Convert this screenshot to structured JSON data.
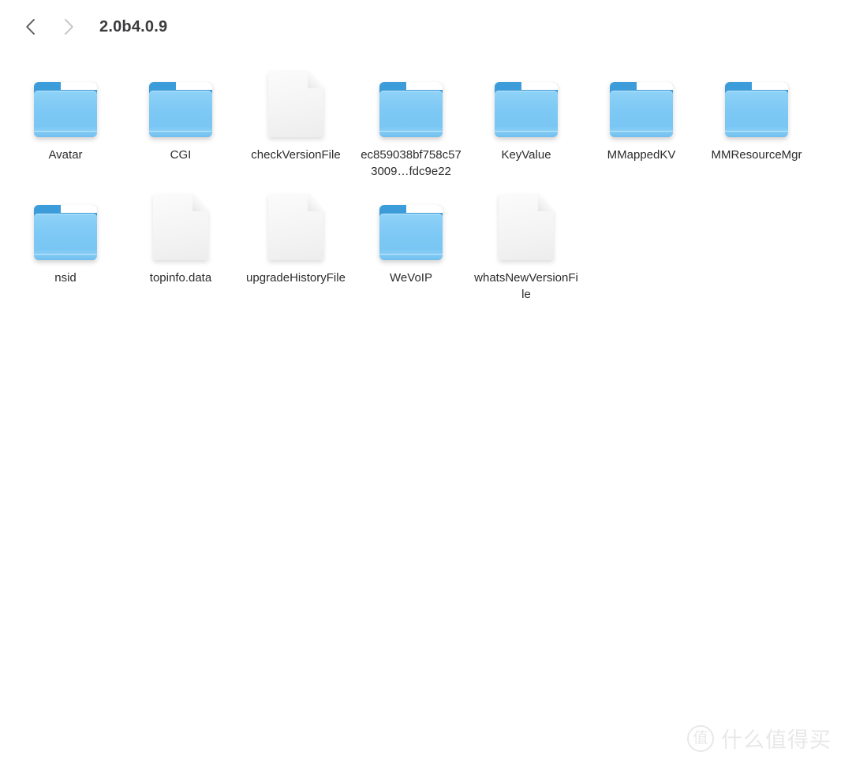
{
  "window": {
    "background_color": "#ffffff"
  },
  "header": {
    "back_button": {
      "icon": "chevron-left-icon",
      "enabled": true,
      "color": "#58585a"
    },
    "forward_button": {
      "icon": "chevron-right-icon",
      "enabled": false,
      "color": "#c3c3c5"
    },
    "title": "2.0b4.0.9"
  },
  "grid": {
    "columns": 6,
    "items": [
      {
        "name": "Avatar",
        "type": "folder"
      },
      {
        "name": "CGI",
        "type": "folder"
      },
      {
        "name": "checkVersionFile",
        "type": "file"
      },
      {
        "name": "ec859038bf758c573009…fdc9e22",
        "type": "folder"
      },
      {
        "name": "KeyValue",
        "type": "folder"
      },
      {
        "name": "MMappedKV",
        "type": "folder"
      },
      {
        "name": "MMResourceMgr",
        "type": "folder"
      },
      {
        "name": "nsid",
        "type": "folder"
      },
      {
        "name": "topinfo.data",
        "type": "file"
      },
      {
        "name": "upgradeHistoryFile",
        "type": "file"
      },
      {
        "name": "WeVoIP",
        "type": "folder"
      },
      {
        "name": "whatsNewVersionFile",
        "type": "file"
      }
    ]
  },
  "watermark": {
    "badge": "值",
    "text": "什么值得买",
    "color": "#e8e8e8"
  },
  "colors": {
    "folder_front": "#7ec9f5",
    "folder_tab": "#3d9ddb",
    "document_page": "#f4f4f4",
    "label_text": "#2c2c2e",
    "title_text": "#3b3b3d"
  }
}
